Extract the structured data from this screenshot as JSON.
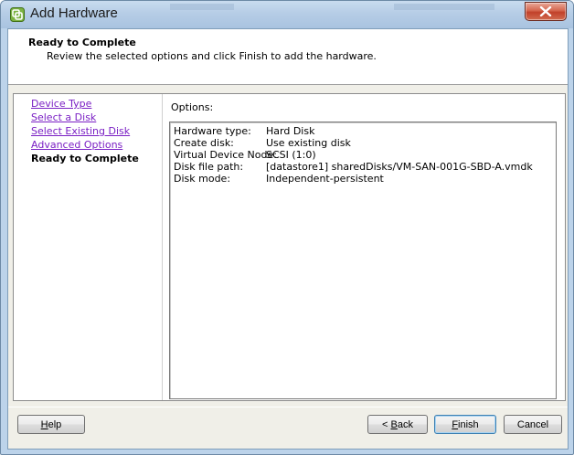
{
  "window": {
    "title": "Add Hardware",
    "app_icon": "vsphere-app-icon",
    "close_icon": "close-x-icon"
  },
  "header": {
    "title": "Ready to Complete",
    "subtitle": "Review the selected options and click Finish to add the hardware."
  },
  "nav": {
    "items": [
      {
        "label": "Device Type",
        "state": "link"
      },
      {
        "label": "Select a Disk",
        "state": "link"
      },
      {
        "label": "Select Existing Disk",
        "state": "link"
      },
      {
        "label": "Advanced Options",
        "state": "link"
      },
      {
        "label": "Ready to Complete",
        "state": "current"
      }
    ]
  },
  "options": {
    "label": "Options:",
    "rows": [
      {
        "key": "Hardware type:",
        "value": "Hard Disk"
      },
      {
        "key": "Create disk:",
        "value": "Use existing disk"
      },
      {
        "key": "Virtual Device Node:",
        "value": "SCSI (1:0)"
      },
      {
        "key": "Disk file path:",
        "value": "[datastore1] sharedDisks/VM-SAN-001G-SBD-A.vmdk"
      },
      {
        "key": "Disk mode:",
        "value": "Independent-persistent"
      }
    ]
  },
  "buttons": {
    "help": {
      "mnemonic": "H",
      "rest": "elp"
    },
    "back": {
      "prefix": "< ",
      "mnemonic": "B",
      "rest": "ack"
    },
    "finish": {
      "mnemonic": "F",
      "rest": "inish"
    },
    "cancel": "Cancel"
  },
  "colors": {
    "link": "#7a1fc4",
    "titlebar": "#b6cde6",
    "close_button": "#c1412a"
  }
}
